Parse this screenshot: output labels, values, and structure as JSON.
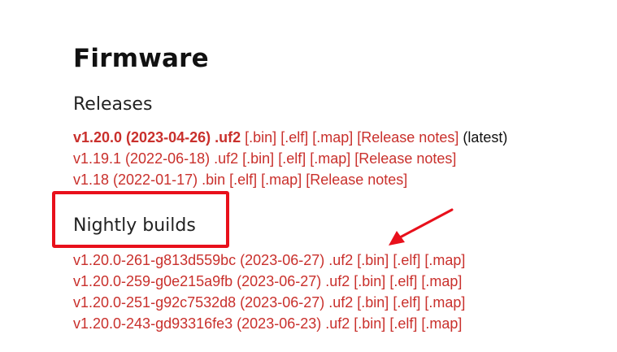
{
  "page": {
    "title": "Firmware"
  },
  "releases": {
    "heading": "Releases",
    "items": [
      {
        "label": "v1.20.0 (2023-04-26) .uf2",
        "links": [
          "[.bin]",
          "[.elf]",
          "[.map]",
          "[Release notes]"
        ],
        "note": "(latest)"
      },
      {
        "label": "v1.19.1 (2022-06-18) .uf2",
        "links": [
          "[.bin]",
          "[.elf]",
          "[.map]",
          "[Release notes]"
        ]
      },
      {
        "label": "v1.18 (2022-01-17) .bin",
        "links": [
          "[.elf]",
          "[.map]",
          "[Release notes]"
        ]
      }
    ]
  },
  "nightly": {
    "heading": "Nightly builds",
    "items": [
      {
        "label": "v1.20.0-261-g813d559bc (2023-06-27) .uf2",
        "links": [
          "[.bin]",
          "[.elf]",
          "[.map]"
        ]
      },
      {
        "label": "v1.20.0-259-g0e215a9fb (2023-06-27) .uf2",
        "links": [
          "[.bin]",
          "[.elf]",
          "[.map]"
        ]
      },
      {
        "label": "v1.20.0-251-g92c7532d8 (2023-06-27) .uf2",
        "links": [
          "[.bin]",
          "[.elf]",
          "[.map]"
        ]
      },
      {
        "label": "v1.20.0-243-gd93316fe3 (2023-06-23) .uf2",
        "links": [
          "[.bin]",
          "[.elf]",
          "[.map]"
        ]
      }
    ]
  },
  "colors": {
    "link": "#c9302c",
    "annotation": "#e8101b",
    "text": "#222222"
  }
}
